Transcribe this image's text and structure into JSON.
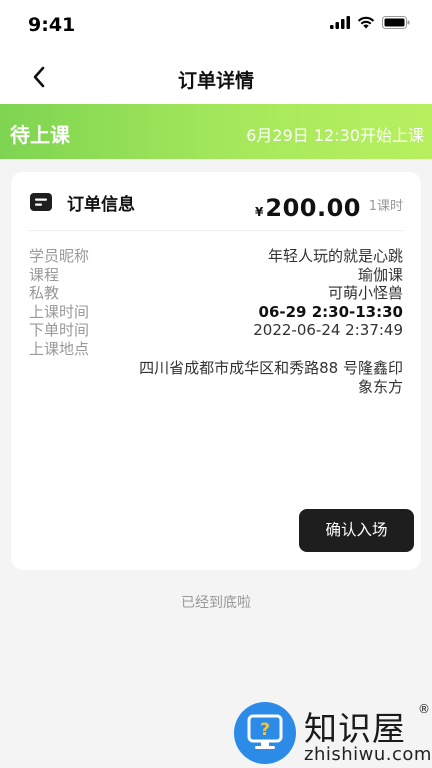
{
  "status_bar": {
    "time": "9:41"
  },
  "nav": {
    "title": "订单详情",
    "back_icon": "chevron-left-icon"
  },
  "banner": {
    "status": "待上课",
    "start_time": "6月29日 12:30开始上课",
    "colors": {
      "start": "#7ed451",
      "end": "#b7f05f"
    }
  },
  "order": {
    "section_title": "订单信息",
    "price_symbol": "¥",
    "price": "200.00",
    "unit": "1课时",
    "labels": {
      "student": "学员昵称",
      "course": "课程",
      "coach": "私教",
      "class_time": "上课时间",
      "order_time": "下单时间",
      "location": "上课地点"
    },
    "values": {
      "student": "年轻人玩的就是心跳",
      "course": "瑜伽课",
      "coach": "可萌小怪兽",
      "class_time": "06-29 2:30-13:30",
      "order_time": "2022-06-24 2:37:49",
      "location": "四川省成都市成华区和秀路88 号隆鑫印象东方"
    },
    "confirm_button": "确认入场"
  },
  "footer": {
    "end_text": "已经到底啦"
  },
  "watermark": {
    "name": "知识屋",
    "reg": "®",
    "url": "zhishiwu.com"
  }
}
